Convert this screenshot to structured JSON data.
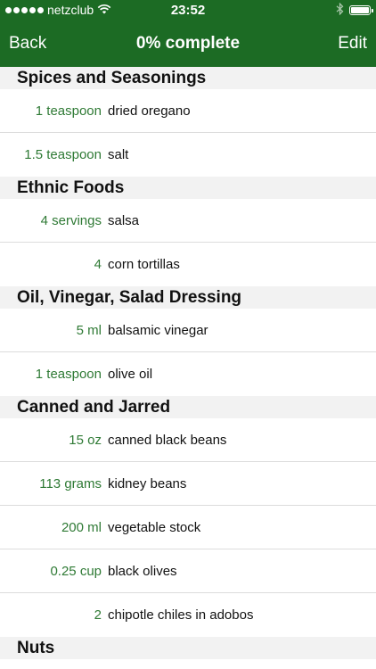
{
  "status_bar": {
    "carrier": "netzclub",
    "time": "23:52",
    "signal_icon": "signal-dots-icon",
    "wifi_icon": "wifi-icon",
    "bluetooth_icon": "bluetooth-icon",
    "battery_icon": "battery-icon",
    "battery_level": 1.0
  },
  "nav": {
    "back_label": "Back",
    "title": "0% complete",
    "edit_label": "Edit"
  },
  "colors": {
    "header_bg": "#1c6b24",
    "quantity_text": "#2f7a35",
    "section_bg": "#f2f2f2"
  },
  "sections": [
    {
      "title": "Spices and Seasonings",
      "items": [
        {
          "qty": "1 teaspoon",
          "name": "dried oregano"
        },
        {
          "qty": "1.5 teaspoon",
          "name": "salt"
        }
      ]
    },
    {
      "title": "Ethnic Foods",
      "items": [
        {
          "qty": "4 servings",
          "name": "salsa"
        },
        {
          "qty": "4",
          "name": "corn tortillas"
        }
      ]
    },
    {
      "title": "Oil, Vinegar, Salad Dressing",
      "items": [
        {
          "qty": "5 ml",
          "name": "balsamic vinegar"
        },
        {
          "qty": "1 teaspoon",
          "name": "olive oil"
        }
      ]
    },
    {
      "title": "Canned and Jarred",
      "items": [
        {
          "qty": "15 oz",
          "name": "canned black beans"
        },
        {
          "qty": "113 grams",
          "name": "kidney beans"
        },
        {
          "qty": "200 ml",
          "name": "vegetable stock"
        },
        {
          "qty": "0.25 cup",
          "name": "black olives"
        },
        {
          "qty": "2",
          "name": "chipotle chiles in adobos"
        }
      ]
    },
    {
      "title": "Nuts",
      "items": []
    }
  ]
}
